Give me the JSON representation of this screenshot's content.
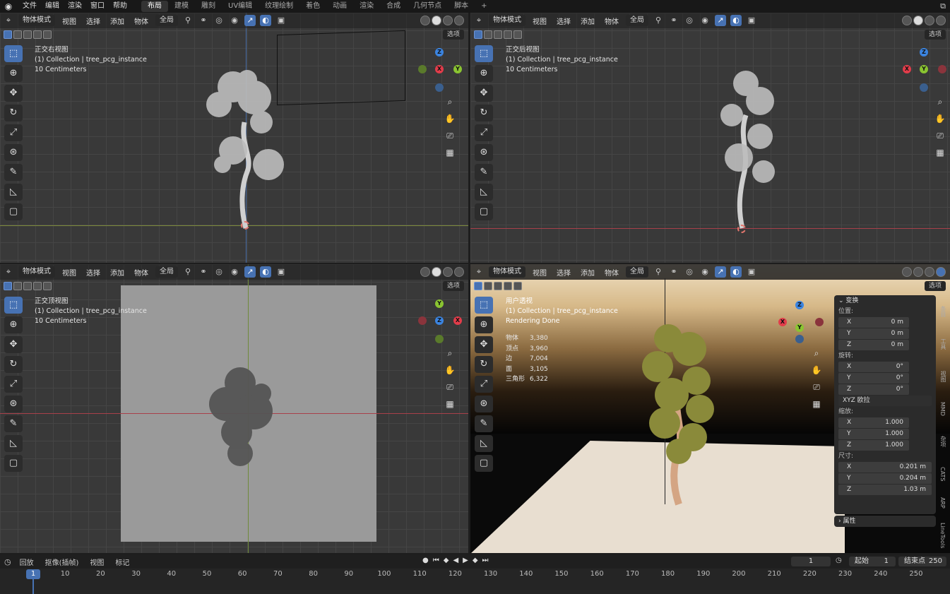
{
  "menubar": {
    "menus": [
      "文件",
      "编辑",
      "渲染",
      "窗口",
      "帮助"
    ],
    "workspaces": [
      "布局",
      "建模",
      "雕刻",
      "UV编辑",
      "纹理绘制",
      "着色",
      "动画",
      "渲染",
      "合成",
      "几何节点",
      "脚本",
      "+"
    ],
    "active_workspace": "布局"
  },
  "viewport_common": {
    "mode": "物体模式",
    "menus": [
      "视图",
      "选择",
      "添加",
      "物体"
    ],
    "transform_orientation": "全局",
    "options_label": "选项",
    "collection_line": "(1) Collection | tree_pcg_instance",
    "scale_line": "10 Centimeters"
  },
  "viewports": {
    "top_left": {
      "name": "正交右视图"
    },
    "top_right": {
      "name": "正交后视图"
    },
    "bottom_left": {
      "name": "正交顶视图"
    },
    "bottom_right": {
      "name": "用户透视",
      "status": "Rendering Done"
    }
  },
  "gizmo_axes": {
    "x": "X",
    "y": "Y",
    "z": "Z"
  },
  "stats": [
    {
      "label": "物体",
      "value": "3,380"
    },
    {
      "label": "顶点",
      "value": "3,960"
    },
    {
      "label": "边",
      "value": "7,004"
    },
    {
      "label": "面",
      "value": "3,105"
    },
    {
      "label": "三角形",
      "value": "6,322"
    }
  ],
  "npanel": {
    "title": "变换",
    "location_label": "位置:",
    "location": [
      {
        "axis": "X",
        "value": "0 m"
      },
      {
        "axis": "Y",
        "value": "0 m"
      },
      {
        "axis": "Z",
        "value": "0 m"
      }
    ],
    "rotation_label": "旋转:",
    "rotation": [
      {
        "axis": "X",
        "value": "0°"
      },
      {
        "axis": "Y",
        "value": "0°"
      },
      {
        "axis": "Z",
        "value": "0°"
      }
    ],
    "rotation_mode": "XYZ 欧拉",
    "scale_label": "缩放:",
    "scale": [
      {
        "axis": "X",
        "value": "1.000"
      },
      {
        "axis": "Y",
        "value": "1.000"
      },
      {
        "axis": "Z",
        "value": "1.000"
      }
    ],
    "dimensions_label": "尺寸:",
    "dimensions": [
      {
        "axis": "X",
        "value": "0.201 m"
      },
      {
        "axis": "Y",
        "value": "0.204 m"
      },
      {
        "axis": "Z",
        "value": "1.03 m"
      }
    ],
    "properties_label": "属性",
    "side_tabs": [
      "条目",
      "工具",
      "视图",
      "MMD",
      "杂项",
      "CATS",
      "ARP",
      "LineTools"
    ]
  },
  "timeline": {
    "menus": [
      "回放",
      "抠像(插帧)",
      "视图",
      "标记"
    ],
    "current_frame": "1",
    "start_label": "起始",
    "start": "1",
    "end_label": "结束点",
    "end": "250",
    "ticks": [
      "1",
      "10",
      "20",
      "30",
      "40",
      "50",
      "60",
      "70",
      "80",
      "90",
      "100",
      "110",
      "120",
      "130",
      "140",
      "150",
      "160",
      "170",
      "180",
      "190",
      "200",
      "210",
      "220",
      "230",
      "240",
      "250"
    ]
  },
  "colors": {
    "accent": "#4772b3",
    "axis_x": "#e23c4a",
    "axis_y": "#8ac431",
    "axis_z": "#3b84e0"
  }
}
